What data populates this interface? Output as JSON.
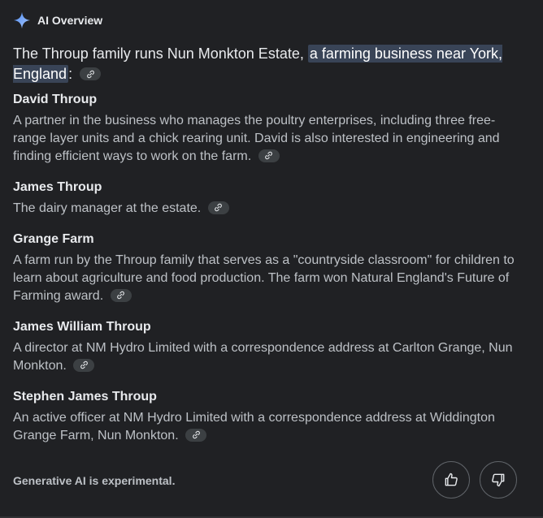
{
  "header": {
    "title": "AI Overview",
    "icon": "sparkle-icon",
    "icon_color": "#8ab4f8"
  },
  "intro": {
    "text_before": "The Throup family runs Nun Monkton Estate,",
    "highlighted": "a farming business near York, England",
    "text_after": ":"
  },
  "sections": [
    {
      "title": "David Throup",
      "body": "A partner in the business who manages the poultry enterprises, including three free-range layer units and a chick rearing unit. David is also interested in engineering and finding efficient ways to work on the farm."
    },
    {
      "title": "James Throup",
      "body": "The dairy manager at the estate."
    },
    {
      "title": "Grange Farm",
      "body": "A farm run by the Throup family that serves as a \"countryside classroom\" for children to learn about agriculture and food production. The farm won Natural England's Future of Farming award."
    },
    {
      "title": "James William Throup",
      "body": "A director at NM Hydro Limited with a correspondence address at Carlton Grange, Nun Monkton."
    },
    {
      "title": "Stephen James Throup",
      "body": "An active officer at NM Hydro Limited with a correspondence address at Widdington Grange Farm, Nun Monkton."
    }
  ],
  "footer": {
    "disclaimer": "Generative AI is experimental.",
    "thumbs_up_icon": "thumbs-up-icon",
    "thumbs_down_icon": "thumbs-down-icon"
  },
  "colors": {
    "background": "#202124",
    "highlight": "#394457",
    "chip": "#3c4043"
  }
}
